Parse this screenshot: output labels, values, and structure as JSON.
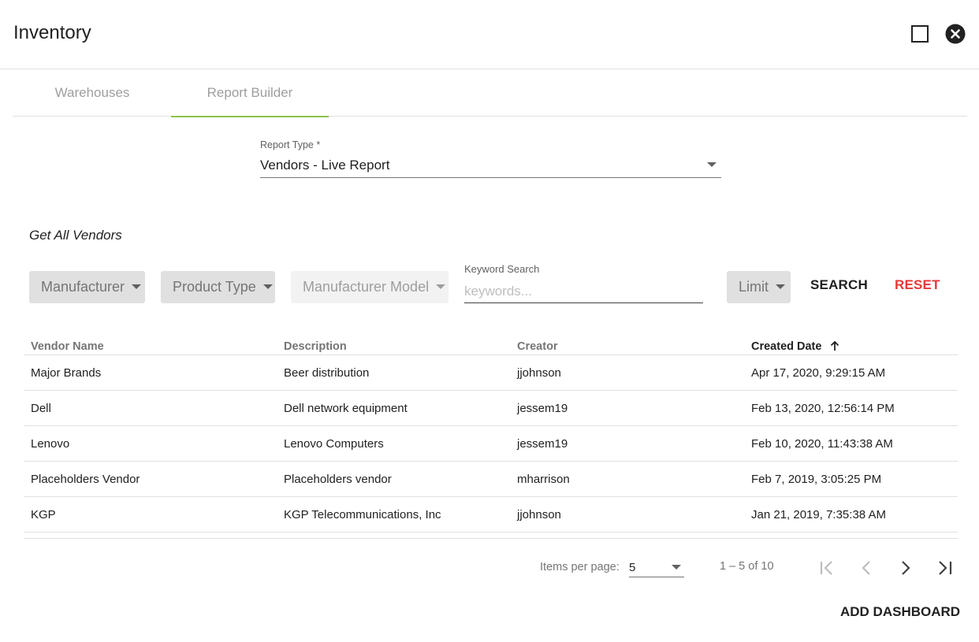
{
  "app": {
    "title": "Inventory"
  },
  "tabs": [
    {
      "label": "Warehouses"
    },
    {
      "label": "Report Builder"
    }
  ],
  "report_type": {
    "label": "Report Type *",
    "value": "Vendors - Live Report"
  },
  "section_title": "Get All Vendors",
  "filters": {
    "manufacturer": "Manufacturer",
    "product_type": "Product Type",
    "manufacturer_model": "Manufacturer Model",
    "keyword_label": "Keyword Search",
    "keyword_placeholder": "keywords...",
    "keyword_value": "",
    "limit": "Limit",
    "search": "SEARCH",
    "reset": "RESET"
  },
  "table": {
    "headers": [
      "Vendor Name",
      "Description",
      "Creator",
      "Created Date"
    ],
    "sort": {
      "column": "Created Date",
      "direction": "ascending"
    },
    "rows": [
      [
        "Major Brands",
        "Beer distribution",
        "jjohnson",
        "Apr 17, 2020, 9:29:15 AM"
      ],
      [
        "Dell",
        "Dell network equipment",
        "jessem19",
        "Feb 13, 2020, 12:56:14 PM"
      ],
      [
        "Lenovo",
        "Lenovo Computers",
        "jessem19",
        "Feb 10, 2020, 11:43:38 AM"
      ],
      [
        "Placeholders Vendor",
        "Placeholders vendor",
        "mharrison",
        "Feb 7, 2019, 3:05:25 PM"
      ],
      [
        "KGP",
        "KGP Telecommunications, Inc",
        "jjohnson",
        "Jan 21, 2019, 7:35:38 AM"
      ]
    ]
  },
  "paginator": {
    "items_per_page_label": "Items per page:",
    "items_per_page": "5",
    "range": "1 – 5 of 10"
  },
  "actions": {
    "add_dashboard": "ADD DASHBOARD"
  },
  "colors": {
    "tab_indicator": "#8bc34a",
    "reset": "#e53935"
  },
  "icons": {
    "maximize": "square-outline-icon",
    "close": "close-circle-icon",
    "sort": "arrow-up-icon",
    "first": "first-page-icon",
    "prev": "chevron-left-icon",
    "next": "chevron-right-icon",
    "last": "last-page-icon"
  }
}
